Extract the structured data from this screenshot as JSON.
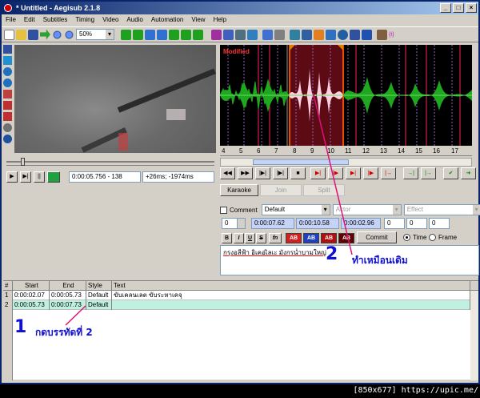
{
  "window": {
    "title": "* Untitled - Aegisub 2.1.8",
    "minimize_label": "_",
    "maximize_label": "□",
    "close_label": "×"
  },
  "menu": [
    "File",
    "Edit",
    "Subtitles",
    "Timing",
    "Video",
    "Audio",
    "Automation",
    "View",
    "Help"
  ],
  "toolbar": {
    "zoom": "50%"
  },
  "video": {
    "time": "0:00:05.756 - 138",
    "offset": "+26ms; -1974ms"
  },
  "audio": {
    "modified_label": "Modified",
    "timeline_labels": [
      "4",
      "5",
      "6",
      "7",
      "8",
      "9",
      "10",
      "11",
      "12",
      "13",
      "14",
      "15",
      "16",
      "17"
    ],
    "karaoke_label": "Karaoke",
    "join_label": "Join",
    "split_label": "Split"
  },
  "edit": {
    "comment_label": "Comment",
    "style": "Default",
    "actor_placeholder": "Actor",
    "effect_placeholder": "Effect",
    "layer": "0",
    "start_time": "0:00:07.62",
    "end_time": "0:00:10.58",
    "duration": "0:00:02.96",
    "margin_l": "0",
    "margin_r": "0",
    "margin_v": "0",
    "bold": "B",
    "italic": "I",
    "underline": "U",
    "strike": "S",
    "font": "fn",
    "color1": "AB",
    "color2": "AB",
    "color3": "AB",
    "color4": "AB",
    "commit_label": "Commit",
    "time_label": "Time",
    "frame_label": "Frame",
    "text": "กรุงอลีฟ้า อิเคอเิลเะ มังกรน่ำบามใหญ่"
  },
  "grid": {
    "headers": [
      "#",
      "Start",
      "End",
      "Style",
      "Text"
    ],
    "rows": [
      {
        "num": "1",
        "start": "0:00:02.07",
        "end": "0:00:05.73",
        "style": "Default",
        "text": "ขับเคลนเลต ขับระหาเคจุ"
      },
      {
        "num": "2",
        "start": "0:00:05.73",
        "end": "0:00:07.73",
        "style": "Default",
        "text": ""
      }
    ]
  },
  "annotations": {
    "step1_number": "1",
    "step1_text": "กดบรรทัดที่ 2",
    "step2_number": "2",
    "step2_text": "ทำเหมือนเดิม"
  },
  "watermark": "[850x677] https://upic.me/",
  "colors": {
    "title_active": "#0a246a",
    "waveform": "#1fa81f",
    "waveform_selected": "#ffd0e0",
    "selection": "#5c0a14",
    "annotation_blue": "#1010d0",
    "annotation_line": "#e0107a"
  }
}
